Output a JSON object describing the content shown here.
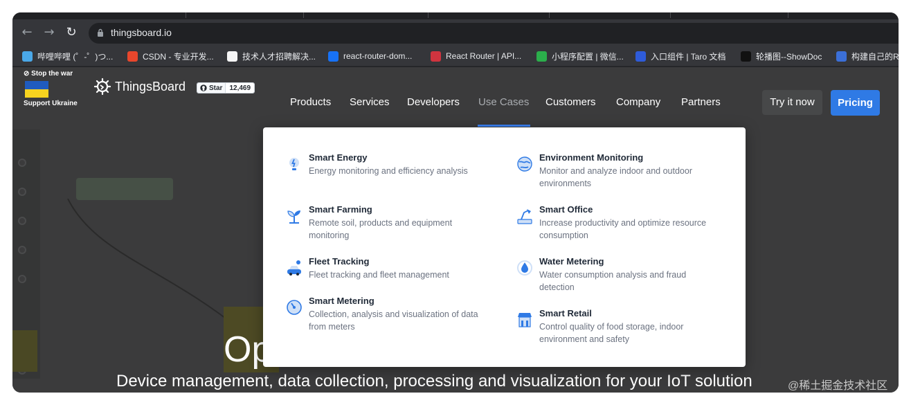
{
  "browser": {
    "url": "thingsboard.io",
    "bookmarks": [
      {
        "label": "哔哩哔哩 (゜-゜)つ...",
        "icon": "bilibili-icon",
        "color": "#4aa8e8"
      },
      {
        "label": "CSDN - 专业开发...",
        "icon": "csdn-icon",
        "color": "#e8462c"
      },
      {
        "label": "技术人才招聘解决...",
        "icon": "recruit-icon",
        "color": "#f5f5f5"
      },
      {
        "label": "react-router-dom...",
        "icon": "zhihu-icon",
        "color": "#1772f6"
      },
      {
        "label": "React Router | API...",
        "icon": "react-router-icon",
        "color": "#d0343f"
      },
      {
        "label": "小程序配置 | 微信...",
        "icon": "wechat-icon",
        "color": "#2bae4b"
      },
      {
        "label": "入口组件 | Taro 文档",
        "icon": "taro-icon",
        "color": "#2e5bd9"
      },
      {
        "label": "轮播图--ShowDoc",
        "icon": "showdoc-icon",
        "color": "#111111"
      },
      {
        "label": "构建自己的R",
        "icon": "layers-icon",
        "color": "#3b6fd8"
      }
    ]
  },
  "site": {
    "banner": {
      "top": "⊘ Stop the war",
      "bottom": "Support Ukraine"
    },
    "logo": "ThingsBoard",
    "github": {
      "label": "Star",
      "count": "12,469"
    },
    "nav": [
      "Products",
      "Services",
      "Developers",
      "Use Cases",
      "Customers",
      "Company",
      "Partners"
    ],
    "active_nav": "Use Cases",
    "try_label": "Try it now",
    "pricing_label": "Pricing",
    "accent": "#2f7ae5"
  },
  "dropdown": {
    "left": [
      {
        "title": "Smart Energy",
        "desc": "Energy monitoring and efficiency analysis",
        "icon": "lightbulb-icon"
      },
      {
        "title": "Smart Farming",
        "desc": "Remote soil, products and equipment monitoring",
        "icon": "sprout-icon"
      },
      {
        "title": "Fleet Tracking",
        "desc": "Fleet tracking and fleet management",
        "icon": "car-location-icon"
      },
      {
        "title": "Smart Metering",
        "desc": "Collection, analysis and visualization of data from meters",
        "icon": "gauge-icon"
      }
    ],
    "right": [
      {
        "title": "Environment Monitoring",
        "desc": "Monitor and analyze indoor and outdoor environments",
        "icon": "globe-icon"
      },
      {
        "title": "Smart Office",
        "desc": "Increase productivity and optimize resource consumption",
        "icon": "desk-lamp-icon"
      },
      {
        "title": "Water Metering",
        "desc": "Water consumption analysis and fraud detection",
        "icon": "water-drop-icon"
      },
      {
        "title": "Smart Retail",
        "desc": "Control quality of food storage, indoor environment and safety",
        "icon": "store-icon"
      }
    ]
  },
  "hero": {
    "big": "Op",
    "sub": "Device management, data collection, processing and visualization for your IoT solution"
  },
  "watermark": "@稀土掘金技术社区"
}
